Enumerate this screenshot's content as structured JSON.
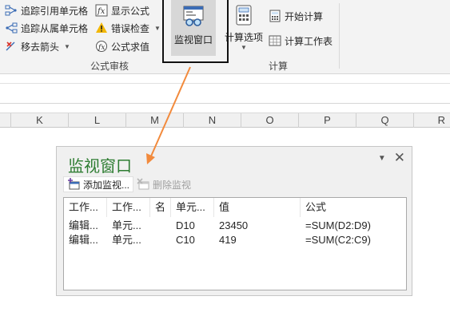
{
  "ribbon": {
    "auditing": {
      "trace_precedents": "追踪引用单元格",
      "trace_dependents": "追踪从属单元格",
      "remove_arrows": "移去箭头",
      "show_formulas": "显示公式",
      "error_checking": "错误检查",
      "evaluate_formula": "公式求值",
      "group_label": "公式审核"
    },
    "watch_window_label": "监视窗口",
    "calculation": {
      "options_label": "计算选项",
      "calc_now": "开始计算",
      "calc_sheet": "计算工作表",
      "group_label": "计算"
    }
  },
  "columns": [
    "K",
    "L",
    "M",
    "N",
    "O",
    "P",
    "Q",
    "R"
  ],
  "watch_pane": {
    "title": "监视窗口",
    "add_watch": "添加监视...",
    "delete_watch": "删除监视",
    "headers": [
      "工作...",
      "工作...",
      "名",
      "单元...",
      "值",
      "公式"
    ],
    "rows": [
      {
        "book": "编辑...",
        "sheet": "单元...",
        "name": "",
        "cell": "D10",
        "value": "23450",
        "formula": "=SUM(D2:D9)"
      },
      {
        "book": "编辑...",
        "sheet": "单元...",
        "name": "",
        "cell": "C10",
        "value": "419",
        "formula": "=SUM(C2:C9)"
      }
    ]
  },
  "colors": {
    "pane_title": "#2e7d32",
    "arrow": "#f28a3c",
    "ribbon_bg": "#f3f3f3"
  }
}
